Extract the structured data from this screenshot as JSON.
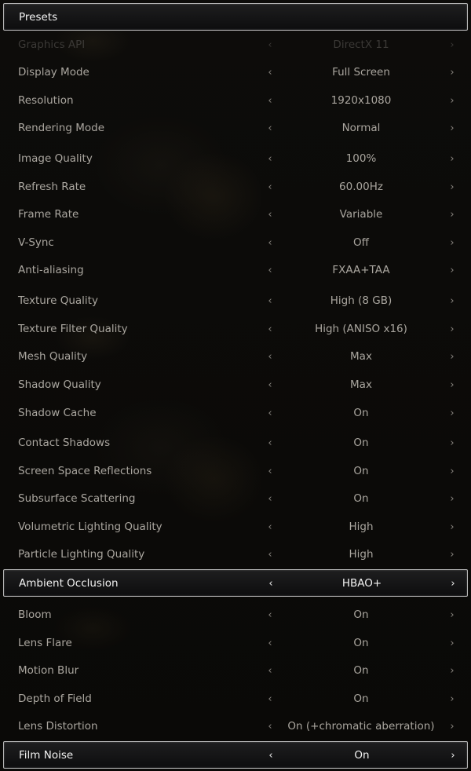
{
  "presets": {
    "label": "Presets"
  },
  "settings": [
    {
      "label": "Graphics API",
      "value": "DirectX 11",
      "state": "disabled"
    },
    {
      "label": "Display Mode",
      "value": "Full Screen"
    },
    {
      "label": "Resolution",
      "value": "1920x1080"
    },
    {
      "label": "Rendering Mode",
      "value": "Normal"
    },
    {
      "label": "Image Quality",
      "value": "100%"
    },
    {
      "label": "Refresh Rate",
      "value": "60.00Hz"
    },
    {
      "label": "Frame Rate",
      "value": "Variable"
    },
    {
      "label": "V-Sync",
      "value": "Off"
    },
    {
      "label": "Anti-aliasing",
      "value": "FXAA+TAA"
    },
    {
      "label": "Texture Quality",
      "value": "High (8 GB)"
    },
    {
      "label": "Texture Filter Quality",
      "value": "High (ANISO x16)"
    },
    {
      "label": "Mesh Quality",
      "value": "Max"
    },
    {
      "label": "Shadow Quality",
      "value": "Max"
    },
    {
      "label": "Shadow Cache",
      "value": "On"
    },
    {
      "label": "Contact Shadows",
      "value": "On"
    },
    {
      "label": "Screen Space Reflections",
      "value": "On"
    },
    {
      "label": "Subsurface Scattering",
      "value": "On"
    },
    {
      "label": "Volumetric Lighting Quality",
      "value": "High"
    },
    {
      "label": "Particle Lighting Quality",
      "value": "High"
    },
    {
      "label": "Ambient Occlusion",
      "value": "HBAO+",
      "state": "highlighted"
    },
    {
      "label": "Bloom",
      "value": "On"
    },
    {
      "label": "Lens Flare",
      "value": "On"
    },
    {
      "label": "Motion Blur",
      "value": "On"
    },
    {
      "label": "Depth of Field",
      "value": "On"
    },
    {
      "label": "Lens Distortion",
      "value": "On (+chromatic aberration)"
    },
    {
      "label": "Film Noise",
      "value": "On",
      "state": "highlighted"
    }
  ],
  "icons": {
    "prev": "chevron-left-icon",
    "next": "chevron-right-icon"
  },
  "glyphs": {
    "prev": "‹",
    "next": "›"
  }
}
